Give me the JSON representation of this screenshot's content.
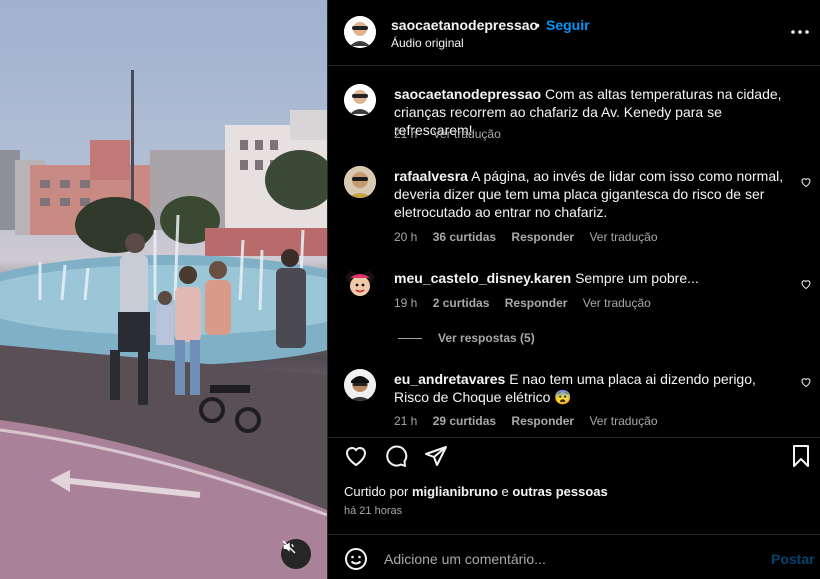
{
  "post": {
    "username": "saocaetanodepressao",
    "separator": "•",
    "follow_label": "Seguir",
    "audio_label": "Áudio original"
  },
  "comments": [
    {
      "username": "saocaetanodepressao",
      "text": "Com as altas temperaturas na cidade, crianças recorrem ao chafariz da Av. Kenedy para se refrescarem!",
      "time": "21 h",
      "translate": "Ver tradução"
    },
    {
      "username": "rafaalvesra",
      "text": "A página, ao invés de lidar com isso como normal, deveria dizer que tem uma placa gigantesca do risco de ser eletrocutado ao entrar no chafariz.",
      "time": "20 h",
      "likes": "36 curtidas",
      "reply": "Responder",
      "translate": "Ver tradução"
    },
    {
      "username": "meu_castelo_disney.karen",
      "text": "Sempre um pobre...",
      "time": "19 h",
      "likes": "2 curtidas",
      "reply": "Responder",
      "translate": "Ver tradução",
      "view_replies": "Ver respostas (5)"
    },
    {
      "username": "eu_andretavares",
      "text": "E nao tem uma placa ai dizendo perigo, Risco de Choque elétrico 😨",
      "time": "21 h",
      "likes": "29 curtidas",
      "reply": "Responder",
      "translate": "Ver tradução"
    }
  ],
  "footer": {
    "liked_prefix": "Curtido por",
    "liked_user": "miglianibruno",
    "liked_and": "e",
    "liked_others": "outras pessoas",
    "time_ago": "há 21 horas",
    "comment_placeholder": "Adicione um comentário...",
    "post_label": "Postar"
  },
  "colors": {
    "background": "#000000",
    "accent": "#0095f6",
    "muted_text": "#a8a8a8",
    "divider": "#262626"
  },
  "icons": [
    "more-options-icon",
    "heart-icon",
    "comment-icon",
    "share-icon",
    "bookmark-icon",
    "emoji-icon",
    "muted-speaker-icon"
  ]
}
